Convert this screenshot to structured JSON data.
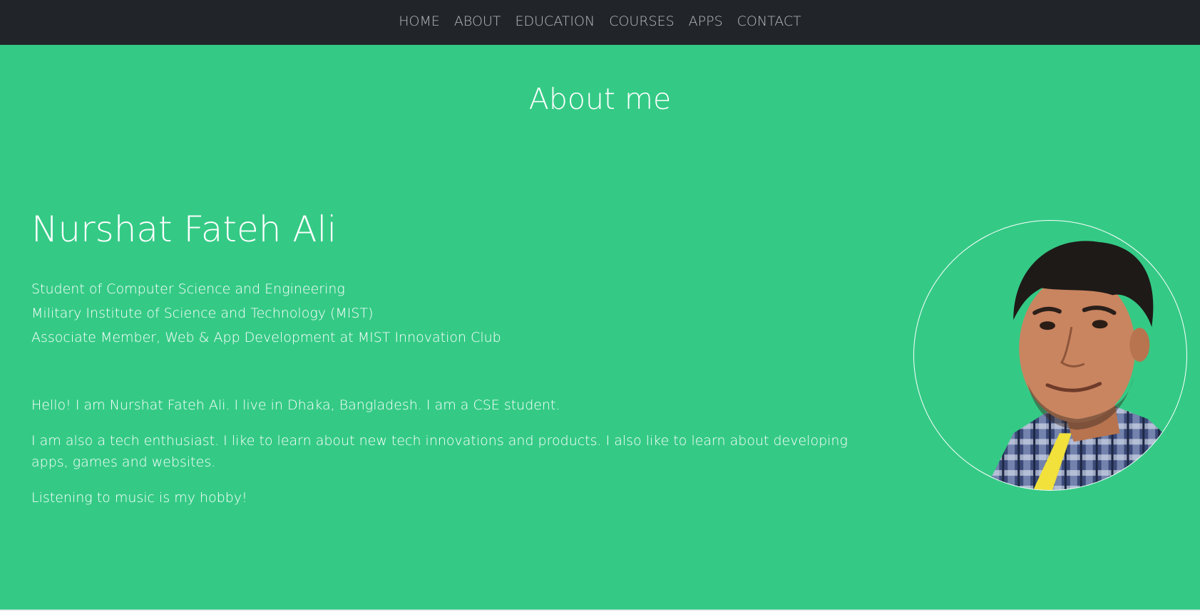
{
  "nav": {
    "items": [
      {
        "label": "HOME"
      },
      {
        "label": "ABOUT"
      },
      {
        "label": "EDUCATION"
      },
      {
        "label": "COURSES"
      },
      {
        "label": "APPS"
      },
      {
        "label": "CONTACT"
      }
    ]
  },
  "about": {
    "title": "About me",
    "name": "Nurshat Fateh Ali",
    "sub_lines": [
      "Student of Computer Science and Engineering",
      "Military Institute of Science and Technology (MIST)",
      "Associate Member, Web & App Development at MIST Innovation Club"
    ],
    "bio": [
      "Hello! I am Nurshat Fateh Ali. I live in Dhaka, Bangladesh. I am a CSE student.",
      "I am also a tech enthusiast. I like to learn about new tech innovations and products. I also like to learn about developing apps, games and websites.",
      "Listening to music is my hobby!"
    ]
  },
  "colors": {
    "nav_bg": "#212529",
    "section_bg": "#34ca85",
    "nav_text": "#b9bcbe",
    "text": "#ffffff"
  }
}
